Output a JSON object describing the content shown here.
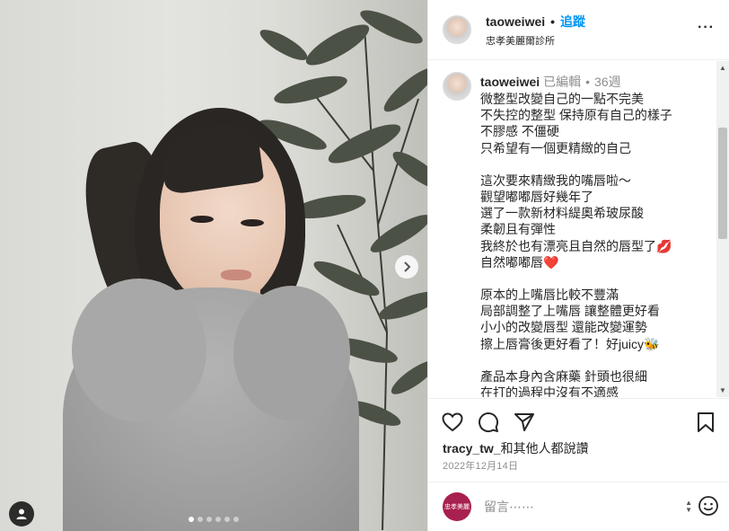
{
  "header": {
    "username": "taoweiwei",
    "separator": "•",
    "follow_label": "追蹤",
    "location": "忠孝美麗爾診所",
    "more_label": "···"
  },
  "caption": {
    "username": "taoweiwei",
    "edited": "已編輯",
    "separator": "•",
    "time": "36週",
    "lines": [
      "微整型改變自己的一點不完美",
      "不失控的整型 保持原有自己的樣子",
      "不膠感 不僵硬",
      "只希望有一個更精緻的自己",
      "",
      "這次要來精緻我的嘴唇啦～",
      "觀望嘟嘟唇好幾年了",
      "選了一款新材料緹奧希玻尿酸",
      "柔韌且有彈性",
      "我終於也有漂亮且自然的唇型了💋",
      "自然嘟嘟唇❤️",
      "",
      "原本的上嘴唇比較不豐滿",
      "局部調整了上嘴唇 讓整體更好看",
      "小小的改變唇型 還能改變運勢",
      "擦上唇膏後更好看了！好juicy🐝",
      "",
      "產品本身內含麻藥 針頭也很細",
      "在打的過程中沒有不適感"
    ]
  },
  "likes": {
    "user": "tracy_tw_",
    "rest": "和其他人都說讚"
  },
  "date": "2022年12月14日",
  "comment": {
    "placeholder": "留言⋯⋯",
    "avatar_text": "忠孝美麗"
  },
  "icons": {
    "like": "heart-icon",
    "comment": "comment-icon",
    "share": "send-icon",
    "save": "bookmark-icon",
    "next": "chevron-right-icon",
    "tag": "user-tag-icon",
    "emoji": "smile-icon"
  },
  "colors": {
    "follow": "#0095f6",
    "secondary_text": "#8e8e8e",
    "border": "#efefef"
  },
  "carousel": {
    "total": 6,
    "active": 1
  }
}
